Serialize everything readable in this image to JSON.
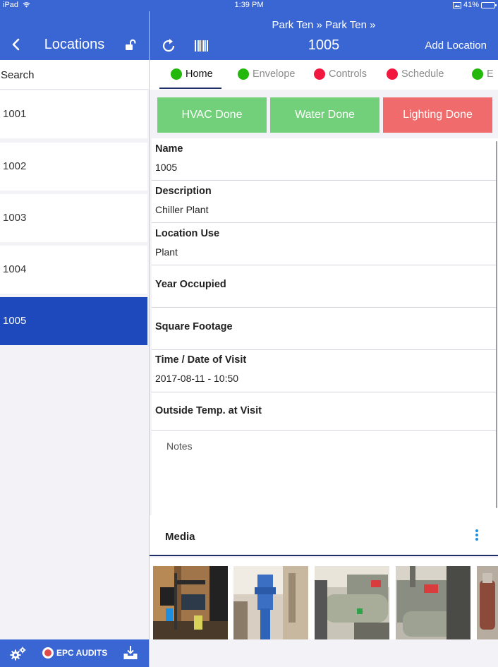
{
  "status_bar": {
    "device": "iPad",
    "time": "1:39 PM",
    "battery": "41%",
    "battery_level": 0.41
  },
  "left_panel": {
    "title": "Locations",
    "search_placeholder": "Search",
    "locations": [
      {
        "label": "1001",
        "selected": false
      },
      {
        "label": "1002",
        "selected": false
      },
      {
        "label": "1003",
        "selected": false
      },
      {
        "label": "1004",
        "selected": false
      },
      {
        "label": "1005",
        "selected": true
      }
    ]
  },
  "header": {
    "breadcrumb": "Park Ten » Park Ten »",
    "title": "1005",
    "add_location": "Add Location"
  },
  "tabs": [
    {
      "label": "Home",
      "color": "#25b80c",
      "active": true
    },
    {
      "label": "Envelope",
      "color": "#25b80c",
      "active": false
    },
    {
      "label": "Controls",
      "color": "#f2173f",
      "active": false
    },
    {
      "label": "Schedule",
      "color": "#f2173f",
      "active": false
    },
    {
      "label": "E",
      "color": "#25b80c",
      "active": false
    }
  ],
  "status_buttons": [
    {
      "label": "HVAC Done",
      "color": "#72cf7a"
    },
    {
      "label": "Water Done",
      "color": "#72cf7a"
    },
    {
      "label": "Lighting Done",
      "color": "#f06b6b"
    }
  ],
  "fields": [
    {
      "label": "Name",
      "value": "1005"
    },
    {
      "label": "Description",
      "value": "Chiller Plant"
    },
    {
      "label": "Location Use",
      "value": "Plant"
    },
    {
      "label": "Year Occupied",
      "value": ""
    },
    {
      "label": "Square Footage",
      "value": ""
    },
    {
      "label": "Time / Date of Visit",
      "value": "2017-08-11 - 10:50"
    },
    {
      "label": "Outside Temp. at Visit",
      "value": ""
    }
  ],
  "notes_placeholder": "Notes",
  "media": {
    "title": "Media"
  },
  "footer": {
    "brand": "EPC AUDITS"
  },
  "colors": {
    "primary": "#3a66d4",
    "selected": "#1e49bd",
    "done": "#72cf7a",
    "not_done": "#f06b6b"
  }
}
